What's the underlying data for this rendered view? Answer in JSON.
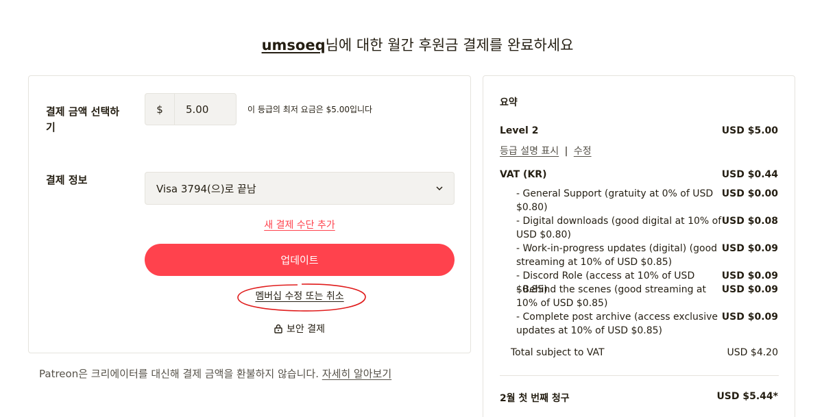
{
  "header": {
    "creator": "umsoeq",
    "title_suffix": "님에 대한 월간 후원금 결제를 완료하세요"
  },
  "amount_section": {
    "label": "결제 금액 선택하기",
    "currency_symbol": "$",
    "amount_value": "5.00",
    "min_note": "이 등급의 최저 요금은 $5.00입니다"
  },
  "payment_section": {
    "label": "결제 정보",
    "selected_method": "Visa 3794(으)로 끝남",
    "add_method_link": "새 결제 수단 추가"
  },
  "actions": {
    "update_button": "업데이트",
    "manage_link": "멤버십 수정 또는 취소",
    "secure_label": "보안 결제"
  },
  "refund_note": {
    "text": "Patreon은 크리에이터를 대신해 결제 금액을 환불하지 않습니다.",
    "learn_more": "자세히 알아보기"
  },
  "summary": {
    "title": "요약",
    "tier_name": "Level 2",
    "tier_amount": "USD $5.00",
    "show_description": "등급 설명 표시",
    "separator": "|",
    "edit": "수정",
    "vat_label": "VAT (KR)",
    "vat_amount": "USD $0.44",
    "vat_items": [
      {
        "label": "- General Support (gratuity at 0% of USD $0.80)",
        "amount": "USD $0.00"
      },
      {
        "label": "- Digital downloads (good digital at 10% of USD $0.80)",
        "amount": "USD $0.08"
      },
      {
        "label": "- Work-in-progress updates (digital) (good streaming at 10% of USD $0.85)",
        "amount": "USD $0.09"
      },
      {
        "label": "- Discord Role (access at 10% of USD $0.85)",
        "amount": "USD $0.09"
      },
      {
        "label": "- Behind the scenes (good streaming at 10% of USD $0.85)",
        "amount": "USD $0.09"
      },
      {
        "label": "- Complete post archive (access exclusive updates at 10% of USD $0.85)",
        "amount": "USD $0.09"
      }
    ],
    "total_subject_label": "Total subject to VAT",
    "total_subject_amount": "USD $4.20",
    "first_charge_label": "2월 첫 번째 청구",
    "first_charge_amount": "USD $5.44*"
  },
  "colors": {
    "accent": "#ff424d",
    "text": "#241e12",
    "muted": "#555148",
    "border": "#e5e3dd",
    "field_bg": "#f3f2ef"
  }
}
